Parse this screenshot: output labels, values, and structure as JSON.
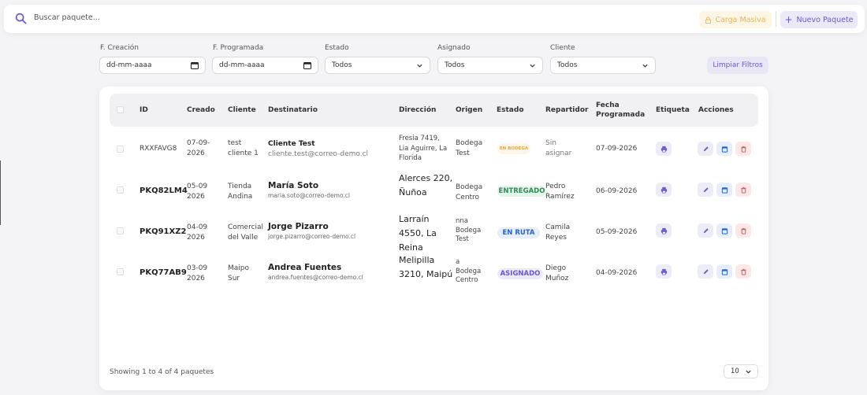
{
  "search": {
    "placeholder": "Buscar paquete..."
  },
  "toolbar": {
    "bulk_label": "Carga Masiva",
    "new_label": "Nuevo Paquete"
  },
  "filters": {
    "created_label": "F. Creación",
    "created_value": "dd-mm-aaaa",
    "scheduled_label": "F. Programada",
    "scheduled_value": "dd-mm-aaaa",
    "status_label": "Estado",
    "status_value": "Todos",
    "assigned_label": "Asignado",
    "assigned_value": "Todos",
    "client_label": "Cliente",
    "client_value": "Todos",
    "clear_label": "Limpiar Filtros"
  },
  "table": {
    "headers": [
      "ID",
      "Creado",
      "Cliente",
      "Destinatario",
      "Dirección",
      "Origen",
      "Estado",
      "Repartidor",
      "Fecha Programada",
      "Etiqueta",
      "Acciones"
    ],
    "rows": [
      {
        "id": "RXXFAVG8",
        "created": "07-09-2026",
        "client": "test cliente 1",
        "recipient": "Cliente Test",
        "email": "cliente.test@correo-demo.cl",
        "address": "Fresia 7419, Lia Aguirre, La Florida",
        "origin": "Bodega Test",
        "status": "EN BODEGA",
        "driver": "Sin asignar",
        "scheduled": "07-09-2026"
      },
      {
        "id": "PKQ82LM4",
        "created": "05-09 2026",
        "client": "Tienda Andina",
        "recipient": "María Soto",
        "email": "maria.soto@correo-demo.cl",
        "address": "Alerces 220, Ñuñoa",
        "origin": "Bodega Centro",
        "status": "ENTREGADO",
        "driver": "Pedro Ramírez",
        "scheduled": "06-09-2026"
      },
      {
        "id": "PKQ91XZ2",
        "created": "04-09 2026",
        "client": "Comercial del Valle",
        "recipient": "Jorge Pizarro",
        "email": "jorge.pizarro@correo-demo.cl",
        "address": "Larraín 4550, La Reina",
        "origin": "nna Bodega Test",
        "status": "EN RUTA",
        "driver": "Camila Reyes",
        "scheduled": "05-09-2026"
      },
      {
        "id": "PKQ77AB9",
        "created": "03-09 2026",
        "client": "Maipo Sur",
        "recipient": "Andrea Fuentes",
        "email": "andrea.fuentes@correo-demo.cl",
        "address": "Melipilla 3210, Maipú",
        "origin": "a Bodega Centro",
        "status": "ASIGNADO",
        "driver": "Diego Muñoz",
        "scheduled": "04-09-2026"
      }
    ]
  },
  "footer": {
    "summary": "Showing 1 to 4 of 4 paquetes",
    "page_size": "10"
  },
  "colors": {
    "accent": "#6a5ac8",
    "warning": "#e7b454",
    "success": "#2e8b57",
    "info": "#2a63c4",
    "danger": "#e05555"
  }
}
